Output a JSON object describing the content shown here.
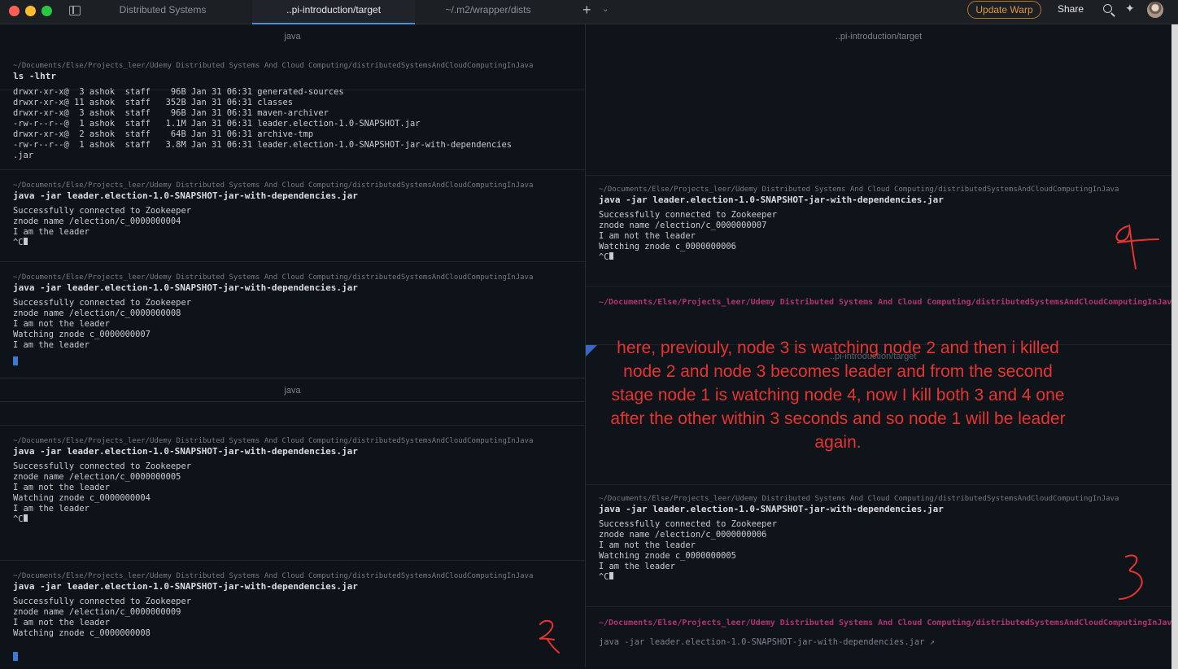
{
  "titlebar": {
    "tabs": [
      "Distributed Systems",
      "..pi-introduction/target",
      "~/.m2/wrapper/dists"
    ],
    "new_tab": "+",
    "tab_menu": "⌄",
    "update_label": "Update Warp",
    "share_label": "Share"
  },
  "left": {
    "header_top": "java",
    "header_mid": "java",
    "block1": {
      "path": "~/Documents/Else/Projects_leer/Udemy Distributed Systems And Cloud Computing/distributedSystemsAndCloudComputingInJava",
      "cmd": "ls -lhtr",
      "lines": [
        "drwxr-xr-x@  3 ashok  staff    96B Jan 31 06:31 generated-sources",
        "drwxr-xr-x@ 11 ashok  staff   352B Jan 31 06:31 classes",
        "drwxr-xr-x@  3 ashok  staff    96B Jan 31 06:31 maven-archiver",
        "-rw-r--r--@  1 ashok  staff   1.1M Jan 31 06:31 leader.election-1.0-SNAPSHOT.jar",
        "drwxr-xr-x@  2 ashok  staff    64B Jan 31 06:31 archive-tmp",
        "-rw-r--r--@  1 ashok  staff   3.8M Jan 31 06:31 leader.election-1.0-SNAPSHOT-jar-with-dependencies",
        ".jar"
      ]
    },
    "block2": {
      "path": "~/Documents/Else/Projects_leer/Udemy Distributed Systems And Cloud Computing/distributedSystemsAndCloudComputingInJava",
      "cmd": "java -jar leader.election-1.0-SNAPSHOT-jar-with-dependencies.jar",
      "lines": [
        "Successfully connected to Zookeeper",
        "znode name /election/c_0000000004",
        "I am the leader",
        "^C"
      ]
    },
    "block3": {
      "path": "~/Documents/Else/Projects_leer/Udemy Distributed Systems And Cloud Computing/distributedSystemsAndCloudComputingInJava",
      "cmd": "java -jar leader.election-1.0-SNAPSHOT-jar-with-dependencies.jar",
      "lines": [
        "Successfully connected to Zookeeper",
        "znode name /election/c_0000000008",
        "I am not the leader",
        "Watching znode c_0000000007",
        "",
        "I am the leader"
      ]
    },
    "block4": {
      "path": "~/Documents/Else/Projects_leer/Udemy Distributed Systems And Cloud Computing/distributedSystemsAndCloudComputingInJava",
      "cmd": "java -jar leader.election-1.0-SNAPSHOT-jar-with-dependencies.jar",
      "lines": [
        "Successfully connected to Zookeeper",
        "znode name /election/c_0000000005",
        "I am not the leader",
        "Watching znode c_0000000004",
        "",
        "I am the leader",
        "",
        "^C"
      ]
    },
    "block5": {
      "path": "~/Documents/Else/Projects_leer/Udemy Distributed Systems And Cloud Computing/distributedSystemsAndCloudComputingInJava",
      "cmd": "java -jar leader.election-1.0-SNAPSHOT-jar-with-dependencies.jar",
      "lines": [
        "Successfully connected to Zookeeper",
        "znode name /election/c_0000000009",
        "I am not the leader",
        "Watching znode c_0000000008"
      ]
    }
  },
  "right": {
    "header_top": "..pi-introduction/target",
    "header_mid": "..pi-introduction/target",
    "block1": {
      "path": "~/Documents/Else/Projects_leer/Udemy Distributed Systems And Cloud Computing/distributedSystemsAndCloudComputingInJava",
      "cmd": "java -jar leader.election-1.0-SNAPSHOT-jar-with-dependencies.jar",
      "lines": [
        "Successfully connected to Zookeeper",
        "znode name /election/c_0000000007",
        "I am not the leader",
        "Watching znode c_0000000006",
        "",
        "^C"
      ]
    },
    "prompt_a": "~/Documents/Else/Projects_leer/Udemy Distributed Systems And Cloud Computing/distributedSystemsAndCloudComputingInJava",
    "block2": {
      "path": "~/Documents/Else/Projects_leer/Udemy Distributed Systems And Cloud Computing/distributedSystemsAndCloudComputingInJava",
      "cmd": "java -jar leader.election-1.0-SNAPSHOT-jar-with-dependencies.jar",
      "lines": [
        "Successfully connected to Zookeeper",
        "znode name /election/c_0000000006",
        "I am not the leader",
        "Watching znode c_0000000005",
        "",
        "I am the leader",
        "^C"
      ]
    },
    "prompt_b": "~/Documents/Else/Projects_leer/Udemy Distributed Systems And Cloud Computing/distributedSystemsAndCloudComputingInJava",
    "input_ghost": "java -jar leader.election-1.0-SNAPSHOT-jar-with-dependencies.jar ↗"
  },
  "annotation": "here, previouly, node 3 is watching node 2 and then i killed node 2 and node 3 becomes leader and from the second stage node 1 is watching node 4, now I kill both 3 and 4 one after the other within 3 seconds and so node 1 will be leader again.",
  "handwritten": [
    "4",
    "3",
    "2"
  ],
  "colors": {
    "annotation": "#e8342f",
    "prompt": "#b03472",
    "accent": "#4a90d9",
    "update": "#e0963f"
  }
}
